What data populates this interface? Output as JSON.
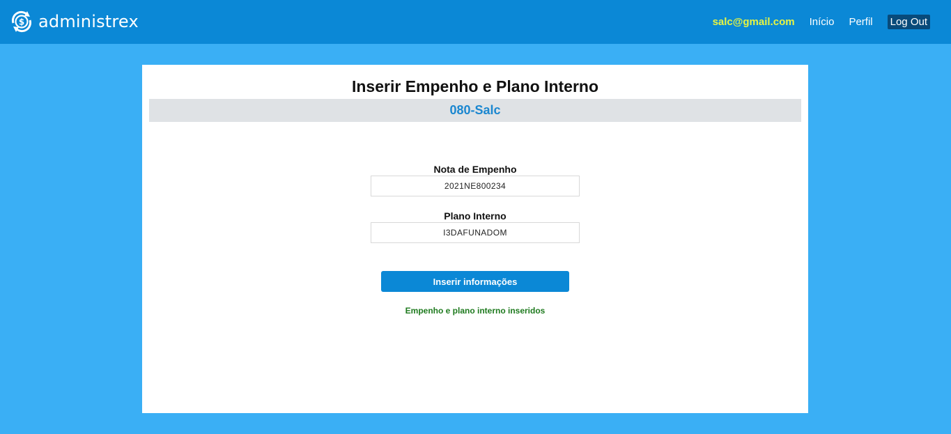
{
  "header": {
    "brand": "administrex",
    "brand_icon": "dollar-refresh-icon",
    "email": "salc@gmail.com",
    "nav": {
      "inicio": "Início",
      "perfil": "Perfil",
      "logout": "Log Out"
    }
  },
  "main": {
    "title": "Inserir Empenho e Plano Interno",
    "unit": "080-Salc",
    "fields": {
      "nota_label": "Nota de Empenho",
      "nota_value": "2021NE800234",
      "plano_label": "Plano Interno",
      "plano_value": "I3DAFUNADOM"
    },
    "submit_label": "Inserir informações",
    "success_message": "Empenho e plano interno inseridos"
  },
  "colors": {
    "page_background": "#3aaff5",
    "navbar": "#0b88d6",
    "email_accent": "#e8f542",
    "logout_background": "#084a7a",
    "unit_text": "#1b87d0",
    "success_text": "#1e7a1e"
  }
}
